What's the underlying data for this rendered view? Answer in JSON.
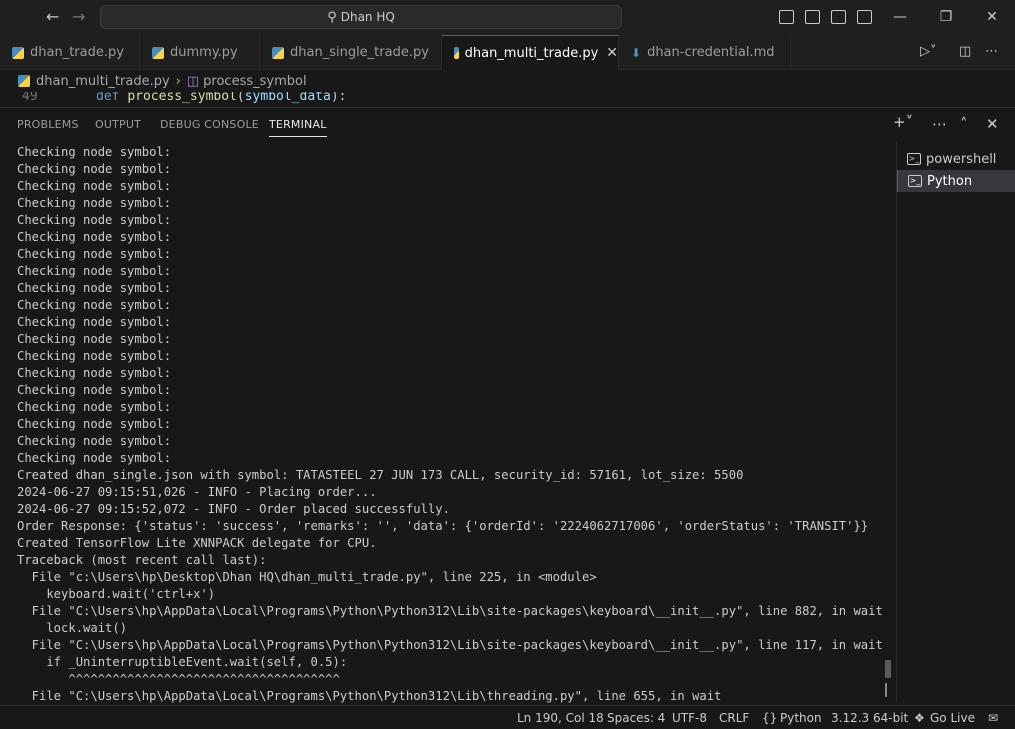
{
  "titlebar": {
    "search_text": "Dhan HQ"
  },
  "tabs": [
    {
      "label": "dhan_trade.py",
      "type": "py"
    },
    {
      "label": "dummy.py",
      "type": "py"
    },
    {
      "label": "dhan_single_trade.py",
      "type": "py"
    },
    {
      "label": "dhan_multi_trade.py",
      "type": "py",
      "active": true
    },
    {
      "label": "dhan-credential.md",
      "type": "md"
    }
  ],
  "breadcrumb": {
    "file": "dhan_multi_trade.py",
    "symbol": "process_symbol"
  },
  "editor_peek": {
    "line_number": "49",
    "keyword": "def",
    "function": "process_symbol",
    "param": "symbol_data"
  },
  "panel": {
    "tabs": [
      "PROBLEMS",
      "OUTPUT",
      "DEBUG CONSOLE",
      "TERMINAL"
    ],
    "active_tab": "TERMINAL"
  },
  "terminal_lines": [
    "Checking node symbol:",
    "Checking node symbol:",
    "Checking node symbol:",
    "Checking node symbol:",
    "Checking node symbol:",
    "Checking node symbol:",
    "Checking node symbol:",
    "Checking node symbol:",
    "Checking node symbol:",
    "Checking node symbol:",
    "Checking node symbol:",
    "Checking node symbol:",
    "Checking node symbol:",
    "Checking node symbol:",
    "Checking node symbol:",
    "Checking node symbol:",
    "Checking node symbol:",
    "Checking node symbol:",
    "Checking node symbol:",
    "Created dhan_single.json with symbol: TATASTEEL 27 JUN 173 CALL, security_id: 57161, lot_size: 5500",
    "2024-06-27 09:15:51,026 - INFO - Placing order...",
    "2024-06-27 09:15:52,072 - INFO - Order placed successfully.",
    "Order Response: {'status': 'success', 'remarks': '', 'data': {'orderId': '2224062717006', 'orderStatus': 'TRANSIT'}}",
    "Created TensorFlow Lite XNNPACK delegate for CPU.",
    "Traceback (most recent call last):",
    "  File \"c:\\Users\\hp\\Desktop\\Dhan HQ\\dhan_multi_trade.py\", line 225, in <module>",
    "    keyboard.wait('ctrl+x')",
    "  File \"C:\\Users\\hp\\AppData\\Local\\Programs\\Python\\Python312\\Lib\\site-packages\\keyboard\\__init__.py\", line 882, in wait",
    "    lock.wait()",
    "  File \"C:\\Users\\hp\\AppData\\Local\\Programs\\Python\\Python312\\Lib\\site-packages\\keyboard\\__init__.py\", line 117, in wait",
    "    if _UninterruptibleEvent.wait(self, 0.5):",
    "       ^^^^^^^^^^^^^^^^^^^^^^^^^^^^^^^^^^^^^",
    "  File \"C:\\Users\\hp\\AppData\\Local\\Programs\\Python\\Python312\\Lib\\threading.py\", line 655, in wait"
  ],
  "terminals": [
    {
      "label": "powershell",
      "active": false
    },
    {
      "label": "Python",
      "active": true
    }
  ],
  "statusbar": {
    "position": "Ln 190, Col 18",
    "spaces": "Spaces: 4",
    "encoding": "UTF-8",
    "eol": "CRLF",
    "language": "Python",
    "interpreter": "3.12.3 64-bit",
    "golive": "Go Live"
  },
  "colors": {
    "accent": "#0078d4",
    "background": "#181818"
  }
}
